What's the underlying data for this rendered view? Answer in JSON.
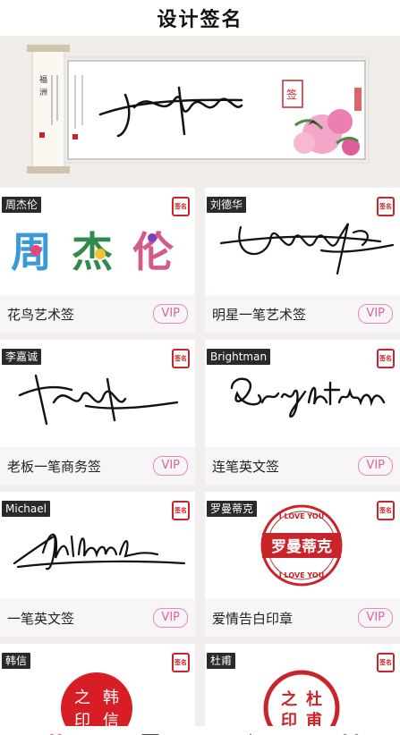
{
  "header": {
    "title": "设计签名"
  },
  "banner": {
    "signature_icon": "calligraphy-signature",
    "scroll_icon": "scroll-painting"
  },
  "cards": [
    {
      "name": "周杰伦",
      "label": "花鸟艺术签",
      "vip": "VIP",
      "style": "flower-bird"
    },
    {
      "name": "刘德华",
      "label": "明星一笔艺术签",
      "vip": "VIP",
      "style": "one-stroke"
    },
    {
      "name": "李嘉诚",
      "label": "老板一笔商务签",
      "vip": "VIP",
      "style": "business"
    },
    {
      "name": "Brightman",
      "label": "连笔英文签",
      "vip": "VIP",
      "style": "english-cursive"
    },
    {
      "name": "Michael",
      "label": "一笔英文签",
      "vip": "VIP",
      "style": "english-one"
    },
    {
      "name": "罗曼蒂克",
      "label": "爱情告白印章",
      "vip": "VIP",
      "style": "love-seal"
    },
    {
      "name": "韩信",
      "label": "",
      "vip": "",
      "style": "round-seal"
    },
    {
      "name": "杜甫",
      "label": "",
      "vip": "",
      "style": "ring-seal"
    }
  ],
  "stamp_text": "签名",
  "colors": {
    "accent": "#d865a0",
    "seal_red": "#c8242a",
    "tag_bg": "#2a2a2a"
  }
}
